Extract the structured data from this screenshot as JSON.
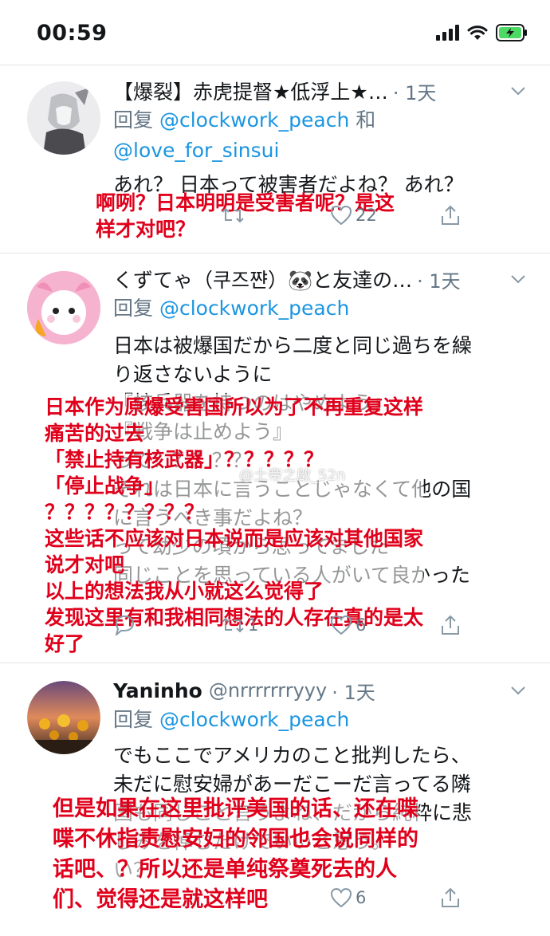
{
  "status": {
    "time": "00:59"
  },
  "watermark": "@土帝之啟_52n",
  "tweets": [
    {
      "author": "【爆裂】赤虎提督★低浮上★…",
      "handle": "",
      "time": "· 1天",
      "reply_prefix": "回复 ",
      "reply_to_1": "@clockwork_peach",
      "reply_mid": " 和",
      "reply_to_2": "@love_for_sinsui",
      "text": [
        "あれ？ 日本って被害者だよね？ あれ？"
      ],
      "retweets": "",
      "likes": "22",
      "translation": [
        "啊咧？日本明明是受害者呢？是这",
        "样才对吧？"
      ]
    },
    {
      "author": "くずてゃ（쿠즈쨘）🐼と友達の…",
      "handle": "",
      "time": "· 1天",
      "reply_prefix": "回复 ",
      "reply_to_1": "@clockwork_peach",
      "text": [
        "日本は被爆国だから二度と同じ過ちを繰",
        "り返さないように",
        "『核兵器を持つのはやめよう』",
        "『戦争は止めよう』",
        "って？？？？？",
        "それは日本に言うことじゃなくて他の国",
        "に言うべき事だよね？",
        "って幼少の頃から思ってました",
        "同じことを思っている人がいて良かった"
      ],
      "retweets": "1",
      "likes": "6",
      "translation": [
        "日本作为原爆受害国所以为了不再重复这样",
        "痛苦的过去",
        "「禁止持有核武器」？？？？？",
        "「停止战争」",
        "？？？？？？？？",
        "这些话不应该对日本说而是应该对其他国家",
        "说才对吧",
        "以上的想法我从小就这么觉得了",
        "发现这里有和我相同想法的人存在真的是太",
        "好了"
      ]
    },
    {
      "author": "Yaninho",
      "handle": "@nrrrrrrryyy",
      "time": "· 1天",
      "reply_prefix": "回复 ",
      "reply_to_1": "@clockwork_peach",
      "text": [
        "でもここでアメリカのこと批判したら、",
        "未だに慰安婦があーだこーだ言ってる隣",
        "国も同じこと言うよね、だから純粋に悲",
        "しみを悼むだけでいいと思う。",
        "い？"
      ],
      "retweets": "",
      "likes": "6",
      "translation": [
        "但是如果在这里批评美国的话、还在喋",
        "喋不休指责慰安妇的邻国也会说同样的",
        "话吧、？所以还是单纯祭奠死去的人",
        "们、觉得还是就这样吧"
      ]
    }
  ]
}
